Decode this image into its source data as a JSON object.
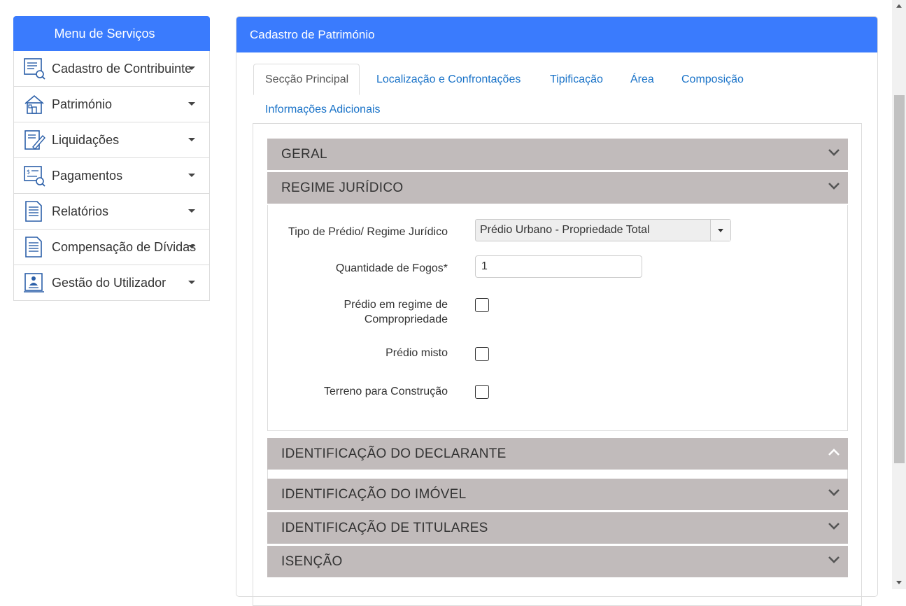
{
  "sidebar": {
    "title": "Menu de Serviços",
    "items": [
      {
        "label": "Cadastro de Contribuinte",
        "icon": "contribuinte-search-icon"
      },
      {
        "label": "Património",
        "icon": "house-icon"
      },
      {
        "label": "Liquidações",
        "icon": "document-edit-icon"
      },
      {
        "label": "Pagamentos",
        "icon": "payment-search-icon"
      },
      {
        "label": "Relatórios",
        "icon": "report-document-icon"
      },
      {
        "label": "Compensação de Dívidas",
        "icon": "report-document-icon"
      },
      {
        "label": "Gestão do Utilizador",
        "icon": "user-management-icon"
      }
    ]
  },
  "main": {
    "title": "Cadastro de Património",
    "tabs": [
      {
        "label": "Secção Principal",
        "active": true
      },
      {
        "label": "Localização e Confrontações"
      },
      {
        "label": "Tipificação"
      },
      {
        "label": "Área"
      },
      {
        "label": "Composição"
      },
      {
        "label": "Informações Adicionais"
      }
    ],
    "sections": [
      {
        "title": "GERAL",
        "state": "collapsed"
      },
      {
        "title": "REGIME JURÍDICO",
        "state": "expanded"
      },
      {
        "title": "IDENTIFICAÇÃO DO DECLARANTE",
        "state": "expanded"
      },
      {
        "title": "IDENTIFICAÇÃO DO IMÓVEL",
        "state": "collapsed"
      },
      {
        "title": "IDENTIFICAÇÃO DE TITULARES",
        "state": "collapsed"
      },
      {
        "title": "ISENÇÃO",
        "state": "collapsed"
      }
    ],
    "form": {
      "tipo_label": "Tipo de Prédio/ Regime Jurídico",
      "tipo_value": "Prédio Urbano - Propriedade Total",
      "fogos_label": "Quantidade de Fogos*",
      "fogos_value": "1",
      "comprop_label_1": "Prédio em regime de",
      "comprop_label_2": "Compropriedade",
      "misto_label": "Prédio misto",
      "terreno_label": "Terreno para Construção"
    }
  },
  "colors": {
    "accent": "#3a7bfd",
    "section_bg": "#c1bbbb",
    "link": "#1a73c8"
  }
}
